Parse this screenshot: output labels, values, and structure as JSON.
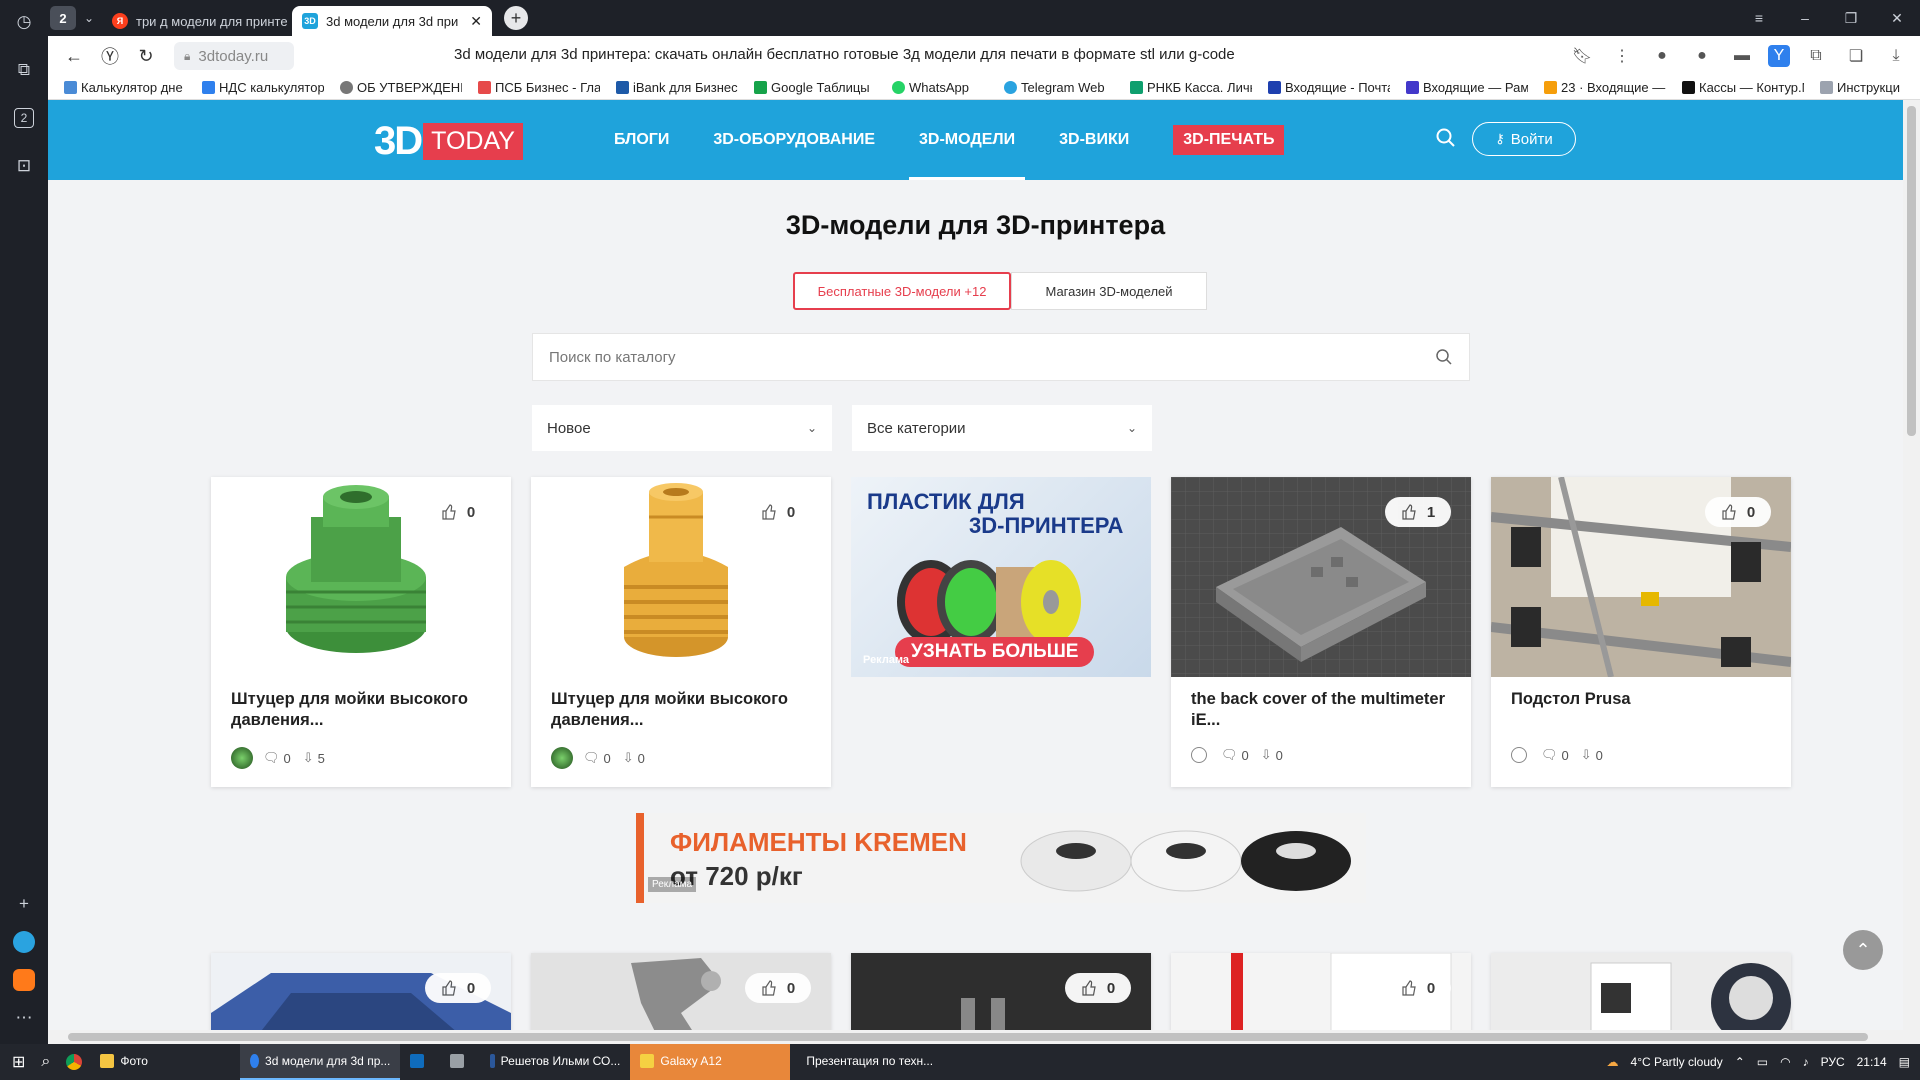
{
  "browser": {
    "tab_count": "2",
    "tabs": [
      {
        "title": "три д модели для принте"
      },
      {
        "title": "3d модели для 3d при"
      }
    ],
    "url": "3dtoday.ru",
    "page_title": "3d модели для 3d принтера: скачать онлайн бесплатно готовые 3д модели для печати в формате stl или g-code",
    "bookmarks": [
      "Калькулятор дне",
      "НДС калькулятор",
      "ОБ УТВЕРЖДЕНИ",
      "ПСБ Бизнес - Гла",
      "iBank для Бизнеса",
      "Google Таблицы",
      "WhatsApp",
      "Telegram Web",
      "РНКБ Касса. Личн",
      "Входящие - Почта",
      "Входящие — Рамб",
      "23 · Входящие — Я",
      "Кассы — Контур.М",
      "Инструкция"
    ],
    "sidebar_badge": "2"
  },
  "site": {
    "logo_3d": "3D",
    "logo_today": "TODAY",
    "nav": [
      "БЛОГИ",
      "3D-ОБОРУДОВАНИЕ",
      "3D-МОДЕЛИ",
      "3D-ВИКИ",
      "3D-ПЕЧАТЬ"
    ],
    "login": "Войти",
    "heading": "3D-модели для 3D-принтера",
    "switch_free": "Бесплатные 3D-модели +12",
    "switch_shop": "Магазин 3D-моделей",
    "search_placeholder": "Поиск по каталогу",
    "sort": "Новое",
    "category": "Все категории",
    "cards": [
      {
        "title": "Штуцер для мойки высокого давления...",
        "likes": "0",
        "comments": "0",
        "downloads": "5"
      },
      {
        "title": "Штуцер для мойки высокого давления...",
        "likes": "0",
        "comments": "0",
        "downloads": "0"
      },
      {
        "title": "the back cover of the multimeter iE...",
        "likes": "1",
        "comments": "0",
        "downloads": "0"
      },
      {
        "title": "Подстол Prusa",
        "likes": "0",
        "comments": "0",
        "downloads": "0"
      }
    ],
    "ad1": {
      "line1": "ПЛАСТИК ДЛЯ",
      "line2": "3D-ПРИНТЕРА",
      "cta": "УЗНАТЬ БОЛЬШЕ",
      "label": "Реклама"
    },
    "banner": {
      "line1": "ФИЛАМЕНТЫ KREMEN",
      "line2": "от 720 р/кг",
      "label": "Реклама"
    },
    "row2_likes": [
      "0",
      "0",
      "0",
      "0"
    ]
  },
  "taskbar": {
    "apps": [
      "Фото",
      "3d модели для 3d пр...",
      "Решетов Ильми СО...",
      "Galaxy A12",
      "Презентация по техн..."
    ],
    "weather": "4°C  Partly cloudy",
    "lang": "РУС",
    "time": "21:14"
  },
  "colors": {
    "accent": "#1fa3db",
    "red": "#e63e4d"
  }
}
